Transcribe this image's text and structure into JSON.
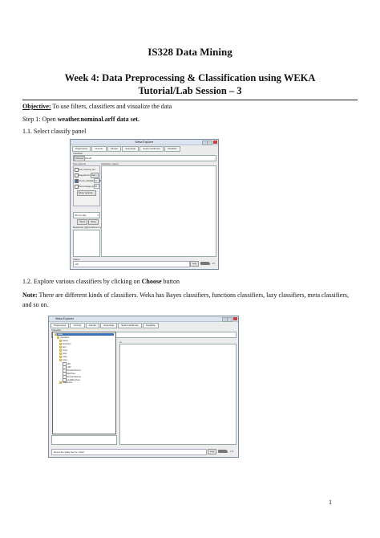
{
  "doc": {
    "title1": "IS328 Data Mining",
    "title2": "Week 4: Data Preprocessing & Classification using WEKA",
    "title3": "Tutorial/Lab Session – 3",
    "objective_label": "Objective:",
    "objective_text": " To use filters, classifiers and visualize the data",
    "step1_prefix": "Step 1: Open ",
    "step1_bold": "weather.nominal.arff data set.",
    "s11": "1.1. Select classify panel",
    "s12_prefix": "1.2. Explore various classifiers by clicking on ",
    "s12_bold": "Choose",
    "s12_suffix": " button",
    "note_label": "Note:",
    "note_text": " There are different kinds of classifiers.  Weka has Bayes classifiers, functions classifiers, lazy classifiers, meta classifiers, and so on.",
    "page_number": "1"
  },
  "weka1": {
    "window_title": "Weka Explorer",
    "tabs": [
      "Preprocess",
      "Classify",
      "Cluster",
      "Associate",
      "Select attributes",
      "Visualize"
    ],
    "classifier_label": "Classifier",
    "choose_label": "Choose",
    "classifier_value": "ZeroR",
    "test_options_label": "Test options",
    "opt1": "Use training set",
    "opt2": "Supplied test set",
    "opt2_btn": "Set...",
    "opt3": "Cross-validation  Folds",
    "opt3_value": "10",
    "opt4": "Percentage split   %",
    "opt4_value": "66",
    "more_options": "More options...",
    "class_value": "(Nom) play",
    "start": "Start",
    "stop": "Stop",
    "result_list": "Result list (right-click for options)",
    "output_label": "Classifier output",
    "status_label": "Status",
    "status_value": "OK",
    "log": "Log",
    "x0": "x 0"
  },
  "weka2": {
    "window_title": "Weka Explorer",
    "tabs": [
      "Preprocess",
      "Classify",
      "Cluster",
      "Associate",
      "Select attributes",
      "Visualize"
    ],
    "classifier_label": "Classifier",
    "tree": [
      "weka",
      "classifiers",
      "bayes",
      "functions",
      "lazy",
      "meta",
      "misc",
      "rules",
      "trees",
      "J48",
      "LMT",
      "RandomForest",
      "REPTree",
      "DecisionStump",
      "HoeffdingTree",
      "rules/extra"
    ],
    "output_label": "ut",
    "status_value": "Reset the Data Set for \"data\"",
    "log": "Log",
    "x0": "x 0"
  }
}
